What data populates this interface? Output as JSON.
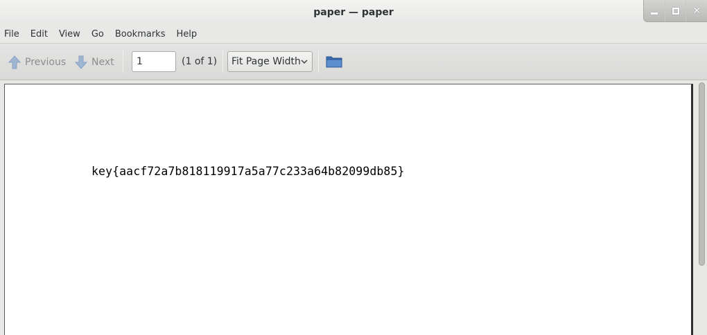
{
  "window": {
    "title": "paper — paper"
  },
  "menubar": {
    "items": [
      "File",
      "Edit",
      "View",
      "Go",
      "Bookmarks",
      "Help"
    ]
  },
  "toolbar": {
    "previous_label": "Previous",
    "next_label": "Next",
    "page_value": "1",
    "page_count": "(1 of 1)",
    "zoom_value": "Fit Page Width",
    "icons": {
      "previous": "arrow-up-icon",
      "next": "arrow-down-icon",
      "open": "folder-icon"
    }
  },
  "document": {
    "text": "key{aacf72a7b818119917a5a77c233a64b82099db85}"
  },
  "colors": {
    "accent": "#4a7fc1",
    "disabled_text": "#8c8c8c"
  }
}
